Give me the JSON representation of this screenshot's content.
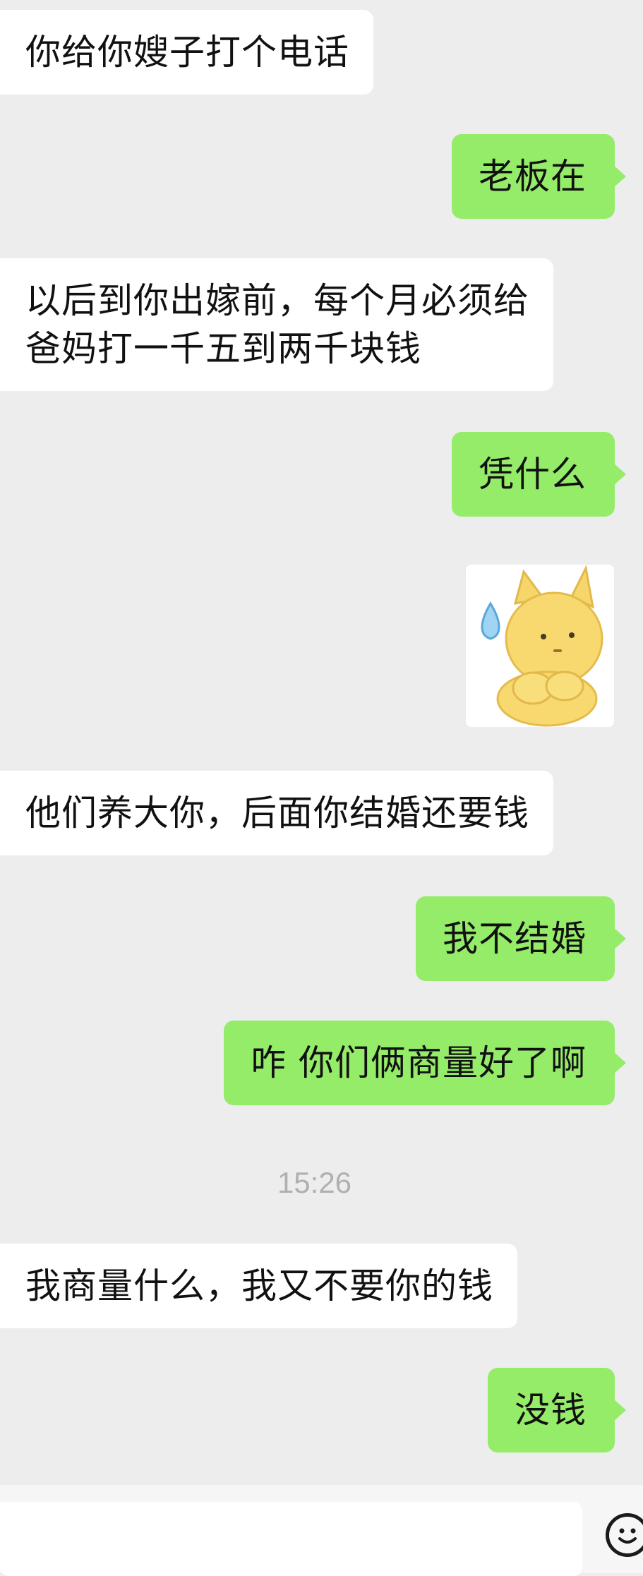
{
  "messages": [
    {
      "side": "left",
      "lines": [
        "你给你嫂子打个电话"
      ]
    },
    {
      "side": "right",
      "lines": [
        "老板在"
      ]
    },
    {
      "side": "left",
      "lines": [
        "以后到你出嫁前，每个月必须给",
        "爸妈打一千五到两千块钱"
      ]
    },
    {
      "side": "right",
      "lines": [
        "凭什么"
      ]
    },
    {
      "side": "right",
      "sticker": "sweating-cat-sticker"
    },
    {
      "side": "left",
      "lines": [
        "他们养大你，后面你结婚还要钱"
      ]
    },
    {
      "side": "right",
      "lines": [
        "我不结婚"
      ]
    },
    {
      "side": "right",
      "lines": [
        "咋 你们俩商量好了啊"
      ]
    },
    {
      "side": "left",
      "lines": [
        "我商量什么，我又不要你的钱"
      ]
    },
    {
      "side": "right",
      "lines": [
        "没钱"
      ]
    }
  ],
  "timestamp": "15:26",
  "input_bar": {
    "emoji_icon": "emoji-smile-icon"
  },
  "colors": {
    "background": "#ededed",
    "incoming_bubble": "#ffffff",
    "outgoing_bubble": "#95ec69",
    "text": "#111111",
    "timestamp": "#b0b0b0"
  }
}
